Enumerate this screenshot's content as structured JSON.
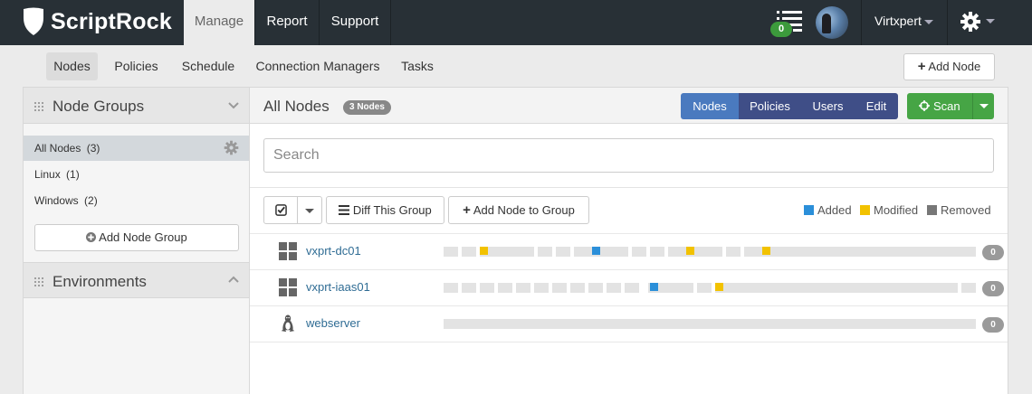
{
  "app": {
    "brand": "ScriptRock",
    "nav_tabs": [
      "Manage",
      "Report",
      "Support"
    ],
    "notification_count": "0",
    "username": "Virtxpert"
  },
  "subnav": {
    "items": [
      "Nodes",
      "Policies",
      "Schedule",
      "Connection Managers",
      "Tasks"
    ],
    "add_node_label": "Add Node"
  },
  "sidebar": {
    "node_groups_title": "Node Groups",
    "groups": [
      {
        "label": "All Nodes",
        "count": "(3)"
      },
      {
        "label": "Linux",
        "count": "(1)"
      },
      {
        "label": "Windows",
        "count": "(2)"
      }
    ],
    "add_group_label": "Add Node Group",
    "environments_title": "Environments"
  },
  "main": {
    "title": "All Nodes",
    "node_count_badge": "3 Nodes",
    "view_tabs": [
      "Nodes",
      "Policies",
      "Users",
      "Edit"
    ],
    "scan_label": "Scan",
    "search_placeholder": "Search",
    "diff_label": "Diff This Group",
    "add_to_group_label": "Add Node to Group",
    "legend": [
      {
        "label": "Added",
        "color": "#2b8fd9"
      },
      {
        "label": "Modified",
        "color": "#f2c200"
      },
      {
        "label": "Removed",
        "color": "#777777"
      }
    ],
    "nodes": [
      {
        "name": "vxprt-dc01",
        "os": "windows-icon",
        "badge": "0"
      },
      {
        "name": "vxprt-iaas01",
        "os": "windows-icon",
        "badge": "0"
      },
      {
        "name": "webserver",
        "os": "linux-icon",
        "badge": "0"
      }
    ]
  },
  "colors": {
    "topbar": "#283036",
    "accent_blue": "#3f4e87",
    "active_blue": "#4a7abf",
    "scan_green": "#46a545",
    "link": "#2f6c94"
  }
}
